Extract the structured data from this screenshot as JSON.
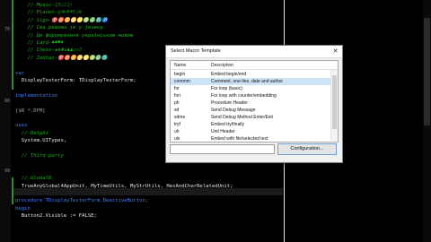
{
  "editor": {
    "gutter_numbers": [
      "70",
      "80",
      "90"
    ],
    "lines": [
      {
        "text": "    // Music-♫♬♩♪♫♮",
        "kind": "comment"
      },
      {
        "text": "    // Planet-♁♃♄♅♆♇☉☿",
        "kind": "comment"
      },
      {
        "text": "    // Sign-♈♉♊♋♌♍♎♏♐",
        "kind": "comment"
      },
      {
        "text": "    // Сва решења је у језику",
        "kind": "comment"
      },
      {
        "text": "    // Це форумування українською мовою",
        "kind": "comment"
      },
      {
        "text": "    // Card-♠♣♥♦",
        "kind": "comment"
      },
      {
        "text": "    // Chess-♚♛♜♝♞♟♔♕♖",
        "kind": "comment"
      },
      {
        "text": "    // Zodiac-♈♉♊♋♌♍♎♏",
        "kind": "comment"
      },
      {
        "text": "",
        "kind": "txt"
      },
      {
        "text": "var",
        "kind": "kw"
      },
      {
        "text": "  DisplayTesterForm: TDisplayTesterForm;",
        "kind": "txt"
      },
      {
        "text": "",
        "kind": "txt"
      },
      {
        "text": "implementation",
        "kind": "kw"
      },
      {
        "text": "",
        "kind": "txt"
      },
      {
        "text": "{$R *.DFM}",
        "kind": "dir"
      },
      {
        "text": "",
        "kind": "txt"
      },
      {
        "text": "uses",
        "kind": "kw"
      },
      {
        "text": "  // Delphi",
        "kind": "comment"
      },
      {
        "text": "  System.UITypes,",
        "kind": "txt"
      },
      {
        "text": "",
        "kind": "txt"
      },
      {
        "text": "  // Third party",
        "kind": "comment"
      },
      {
        "text": "",
        "kind": "txt"
      },
      {
        "text": "",
        "kind": "txt"
      },
      {
        "text": "  // Global6",
        "kind": "comment"
      },
      {
        "text": "  TrueAnyGlobal4AppUnit, MyTimeUtils, MyStrUtils, HexAndCharRelatedUnit;",
        "kind": "txt"
      },
      {
        "text": "",
        "kind": "txt"
      },
      {
        "text": "procedure TDisplayTesterForm.DeactiveButton;",
        "kind": "kw"
      },
      {
        "text": "begin",
        "kind": "kw"
      },
      {
        "text": "  Button2.Visible := FALSE;",
        "kind": "txt"
      }
    ]
  },
  "dialog": {
    "title": "Select Macro Template",
    "close_glyph": "✕",
    "columns": {
      "name": "Name",
      "description": "Description"
    },
    "rows": [
      {
        "name": "begin",
        "description": "Embed begin/end"
      },
      {
        "name": "commm",
        "description": "Comment, one-line, date and author"
      },
      {
        "name": "for",
        "description": "For loop (basic)"
      },
      {
        "name": "fori",
        "description": "For loop with counter/embedding"
      },
      {
        "name": "ph",
        "description": "Procedure Header"
      },
      {
        "name": "sd",
        "description": "Send Debug Message"
      },
      {
        "name": "sdme",
        "description": "Send Debug Method Enter/Exit"
      },
      {
        "name": "tryf",
        "description": "Embed try/finally"
      },
      {
        "name": "uh",
        "description": "Unit Header"
      },
      {
        "name": "uls",
        "description": "Embed with file/selected text"
      }
    ],
    "selected_index": 1,
    "filter_value": "",
    "config_button": "Configuration..."
  }
}
